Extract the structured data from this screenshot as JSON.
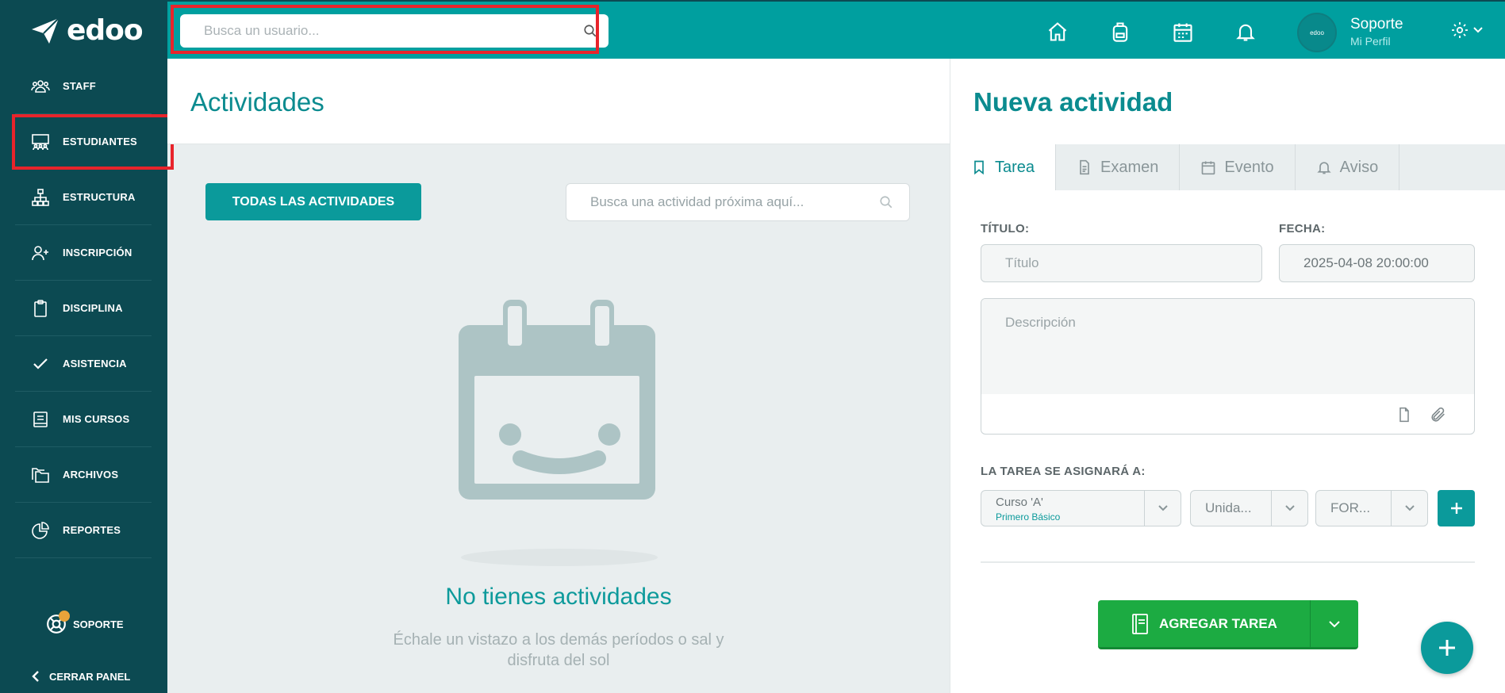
{
  "app": {
    "logo_text": "edoo"
  },
  "sidebar": {
    "items": [
      {
        "label": "STAFF",
        "icon": "staff-icon"
      },
      {
        "label": "ESTUDIANTES",
        "icon": "students-icon"
      },
      {
        "label": "ESTRUCTURA",
        "icon": "structure-icon"
      },
      {
        "label": "INSCRIPCIÓN",
        "icon": "add-user-icon"
      },
      {
        "label": "DISCIPLINA",
        "icon": "clipboard-icon"
      },
      {
        "label": "ASISTENCIA",
        "icon": "check-icon"
      },
      {
        "label": "MIS CURSOS",
        "icon": "book-icon"
      },
      {
        "label": "ARCHIVOS",
        "icon": "folders-icon"
      },
      {
        "label": "REPORTES",
        "icon": "pie-chart-icon"
      }
    ],
    "support_label": "SOPORTE",
    "close_label": "CERRAR PANEL"
  },
  "topbar": {
    "search_placeholder": "Busca un usuario...",
    "profile_name": "Soporte",
    "profile_sub": "Mi Perfil",
    "avatar_text": "edoo"
  },
  "main": {
    "title": "Actividades",
    "all_button": "TODAS LAS ACTIVIDADES",
    "search_placeholder": "Busca una actividad próxima aquí...",
    "empty_title": "No tienes actividades",
    "empty_sub_line1": "Échale un vistazo a los demás períodos o sal y",
    "empty_sub_line2": "disfruta del sol"
  },
  "panel": {
    "title": "Nueva actividad",
    "tabs": [
      {
        "label": "Tarea",
        "icon": "bookmark-icon"
      },
      {
        "label": "Examen",
        "icon": "document-icon"
      },
      {
        "label": "Evento",
        "icon": "calendar-icon"
      },
      {
        "label": "Aviso",
        "icon": "bell-icon"
      }
    ],
    "title_label": "TÍTULO:",
    "title_placeholder": "Título",
    "date_label": "FECHA:",
    "date_value": "2025-04-08 20:00:00",
    "description_placeholder": "Descripción",
    "assign_label": "LA TAREA SE ASIGNARÁ A:",
    "course_value": "Curso 'A'",
    "course_sub": "Primero Básico",
    "unit_value": "Unida...",
    "form_value": "FOR...",
    "add_button": "AGREGAR TAREA"
  },
  "colors": {
    "sidebar": "#0c4a52",
    "topbar": "#009f9f",
    "accent": "#0b9a9b",
    "add_button": "#1cab42",
    "highlight": "#e8242b"
  }
}
